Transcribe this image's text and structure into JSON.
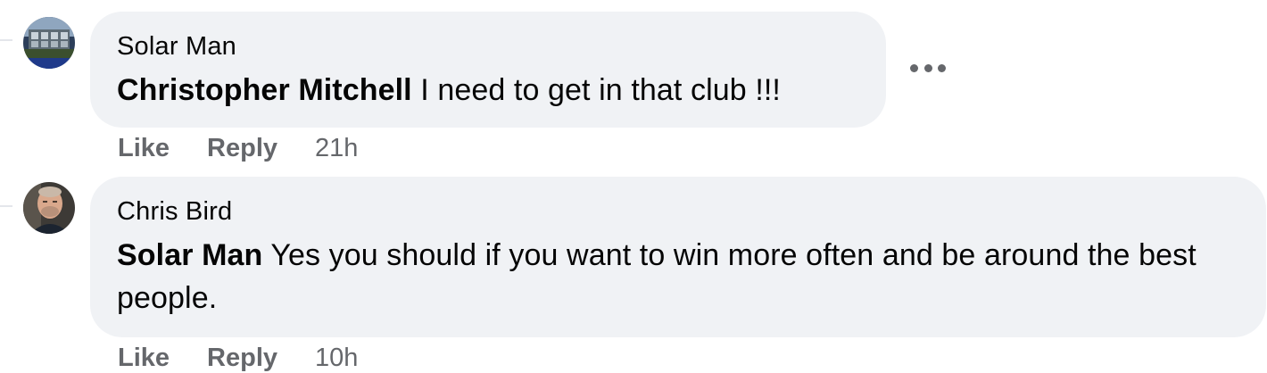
{
  "comments": [
    {
      "author": "Solar Man",
      "mention": "Christopher Mitchell",
      "text": " I need to get in that club !!!",
      "like_label": "Like",
      "reply_label": "Reply",
      "time": "21h"
    },
    {
      "author": "Chris Bird",
      "mention": "Solar Man",
      "text": " Yes you should if you want to win more often and be around the best people.",
      "like_label": "Like",
      "reply_label": "Reply",
      "time": "10h"
    }
  ],
  "icons": {
    "more_options": "more-options-icon"
  },
  "colors": {
    "bubble_bg": "#f0f2f5",
    "secondary_text": "#65676b",
    "primary_text": "#050505"
  }
}
